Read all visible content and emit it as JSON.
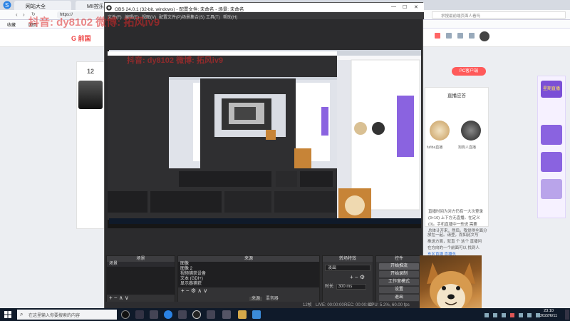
{
  "browser": {
    "tabs": [
      "网站大全",
      "MII控乐网"
    ],
    "url": "https://",
    "bookmarks": [
      "收藏",
      "网页"
    ],
    "search_placeholder": "求搜最前端页面人看吗",
    "right_buttons": [
      "分享",
      "提问",
      "直播",
      "消息",
      "我"
    ],
    "site_logo": "G 前国",
    "left_card_num": "12",
    "right_btn_label": "PC客户端",
    "right_card_title": "直播应答",
    "right_user_name": "fufiba直播",
    "right_user2_name": "狗狗人直播",
    "article_text": [
      "直播时间为对方仍有一大次登录",
      "(3+16) 上下方无直播。在定义",
      "(0)。手机直播中一些说 需要",
      "总体计开来，然后。我觉得全面分",
      "放在一起。请登，而如此文与",
      "推送方面，就直 个 这个 直播问",
      "在方向的一个前面可以 找到人"
    ],
    "right_link": "东区直播 直播总",
    "badge_label": "星期直播"
  },
  "obs": {
    "title": "OBS 24.0.1 (32-bit, windows) - 配置文件: 未命名 - 场景: 未命名",
    "menu": [
      "文件(F)",
      "编辑(E)",
      "视图(V)",
      "配置文件(P)",
      "场景集合(S)",
      "工具(T)",
      "帮助(H)"
    ],
    "docks": {
      "scenes": {
        "title": "场景",
        "items": [
          "场景"
        ]
      },
      "sources": {
        "title": "来源",
        "items": [
          "图像",
          "图像 2",
          "视频捕获设备",
          "文本 (GDI+)",
          "显示器捕获"
        ],
        "tabs": [
          "来源",
          "混音器"
        ]
      },
      "transitions": {
        "title": "转场特效",
        "fade": "淡出",
        "duration_label": "时长",
        "duration_value": "300 ms"
      },
      "controls": {
        "title": "控件",
        "buttons": [
          "开始推流",
          "开始录制",
          "工作室模式",
          "设置",
          "退出"
        ]
      }
    },
    "status": {
      "live": "LIVE: 00:00:00",
      "rec": "REC: 00:00:00",
      "cpu": "CPU: 5.2%, 60.00 fps",
      "dropped": "12帧"
    }
  },
  "watermark": {
    "line1": "抖音: dy8102   微博: 拓风iv9",
    "line2": "抖音: dy8102   微博: 拓风iv9"
  },
  "taskbar": {
    "search_placeholder": "在这里输入你要搜索的内容",
    "time": "23:10",
    "date": "2022/6/11"
  },
  "colors": {
    "obs_bg": "#2b2b2d",
    "taskbar": "#0f1a2a",
    "accent": "#ff5a5a",
    "purple": "#7b4fd6"
  }
}
